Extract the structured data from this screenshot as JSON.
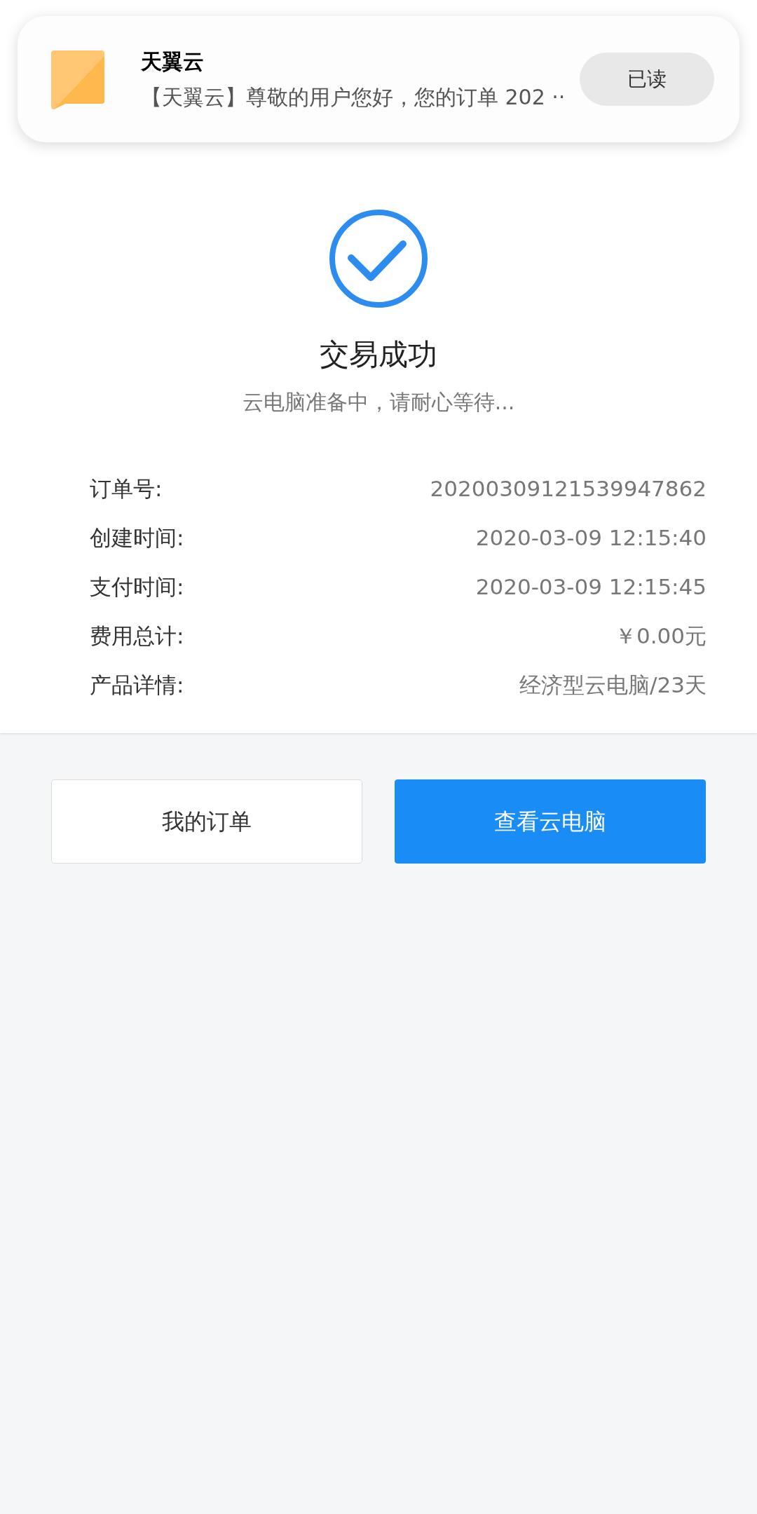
{
  "notification": {
    "app": "天翼云",
    "message": "【天翼云】尊敬的用户您好，您的订单 202 ··",
    "button": "已读"
  },
  "result": {
    "title": "交易成功",
    "subtitle": "云电脑准备中，请耐心等待..."
  },
  "details": [
    {
      "label": "订单号:",
      "value": "20200309121539947862"
    },
    {
      "label": "创建时间:",
      "value": "2020-03-09 12:15:40"
    },
    {
      "label": "支付时间:",
      "value": "2020-03-09 12:15:45"
    },
    {
      "label": "费用总计:",
      "value": "￥0.00元"
    },
    {
      "label": "产品详情:",
      "value": "经济型云电脑/23天"
    }
  ],
  "buttons": [
    {
      "label": "我的订单",
      "kind": "secondary"
    },
    {
      "label": "查看云电脑",
      "kind": "primary"
    }
  ]
}
